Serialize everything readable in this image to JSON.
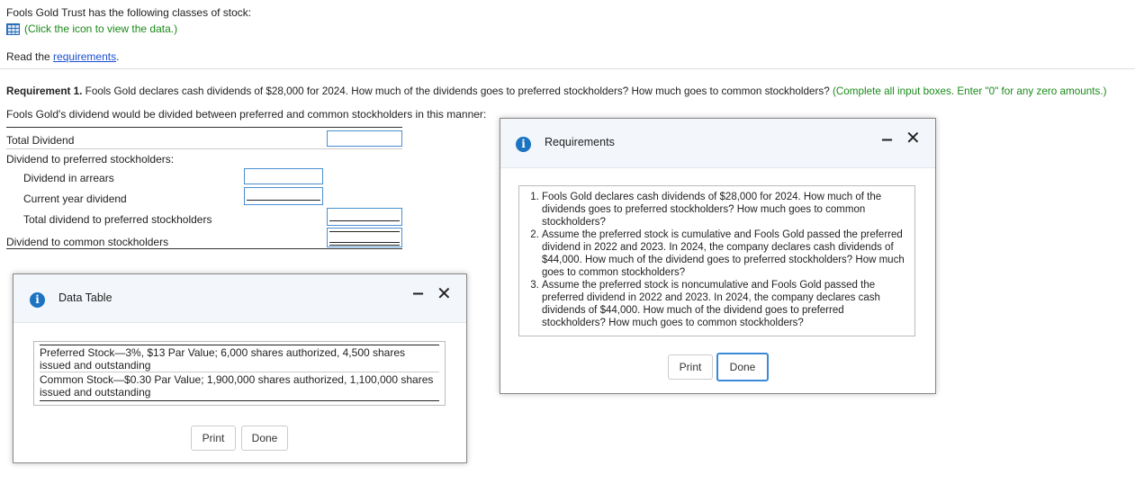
{
  "intro": {
    "line1": "Fools Gold Trust has the following classes of stock:",
    "data_link": "(Click the icon to view the data.)",
    "read_prefix": "Read the ",
    "read_link": "requirements",
    "read_suffix": "."
  },
  "requirement": {
    "bold": "Requirement 1.",
    "text": " Fools Gold declares cash dividends of $28,000 for 2024. How much of the dividends goes to preferred stockholders? How much goes to common stockholders?",
    "hint": " (Complete all input boxes. Enter \"0\" for any zero amounts.)",
    "subtitle": "Fools Gold's dividend would be divided between preferred and common stockholders in this manner:"
  },
  "table": {
    "total_dividend": "Total Dividend",
    "preferred_header": "Dividend to preferred stockholders:",
    "arrears": "Dividend in arrears",
    "current_year": "Current year dividend",
    "total_preferred": "Total dividend to preferred stockholders",
    "common": "Dividend to common stockholders"
  },
  "data_table": {
    "title": "Data Table",
    "row1": "Preferred Stock—3%, $13 Par Value; 6,000 shares authorized, 4,500 shares issued and outstanding",
    "row2": "Common Stock—$0.30 Par Value; 1,900,000 shares authorized, 1,100,000 shares issued and outstanding",
    "print": "Print",
    "done": "Done"
  },
  "requirements_win": {
    "title": "Requirements",
    "items": [
      "Fools Gold declares cash dividends of $28,000 for 2024. How much of the dividends goes to preferred stockholders? How much goes to common stockholders?",
      "Assume the preferred stock is cumulative and Fools Gold passed the preferred dividend in 2022 and 2023. In 2024, the company declares cash dividends of $44,000. How much of the dividend goes to preferred stockholders? How much goes to common stockholders?",
      "Assume the preferred stock is noncumulative and Fools Gold passed the preferred dividend in 2022 and 2023. In 2024, the company declares cash dividends of $44,000. How much of the dividend goes to preferred stockholders? How much goes to common stockholders?"
    ],
    "print": "Print",
    "done": "Done"
  },
  "icons": {
    "info": "i",
    "minimize": "‒",
    "close": "✕"
  }
}
